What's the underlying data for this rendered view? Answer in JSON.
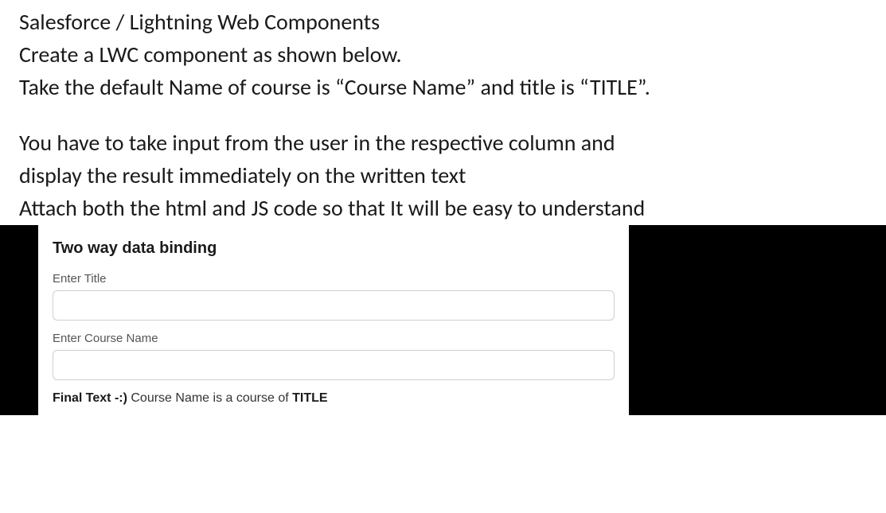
{
  "doc": {
    "line1": "Salesforce / Lightning Web Components",
    "line2": "Create a LWC component as shown below.",
    "line3": "Take the default Name of course is “Course Name” and title is “TITLE”.",
    "line4": "You have to take input from the user in the respective column and",
    "line5": "display the result immediately on the written text",
    "line6": "Attach both the html and JS code so that It will be easy to understand"
  },
  "card": {
    "heading": "Two way data binding",
    "title_label": "Enter Title",
    "title_value": "",
    "course_label": "Enter Course Name",
    "course_value": "",
    "final_prefix": "Final Text -:) ",
    "final_course": "Course Name",
    "final_mid": " is a course of ",
    "final_title": "TITLE"
  }
}
